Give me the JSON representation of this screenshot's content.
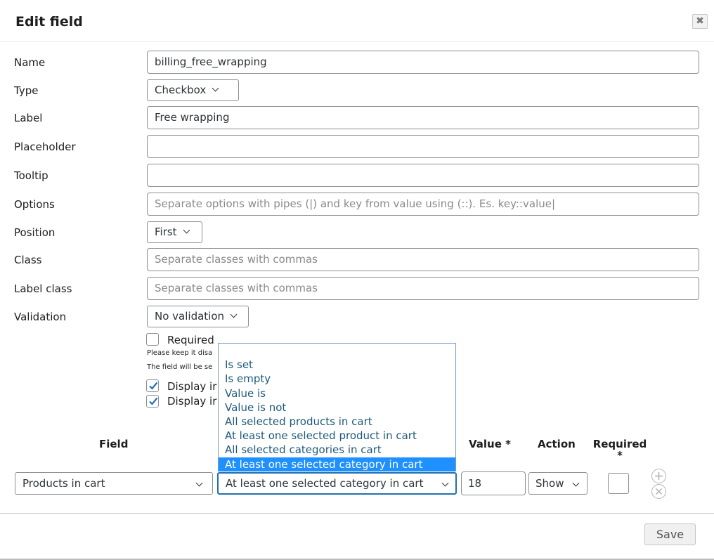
{
  "dialog": {
    "title": "Edit field",
    "close_symbol": "✖",
    "save_label": "Save"
  },
  "form": {
    "name": {
      "label": "Name",
      "value": "billing_free_wrapping"
    },
    "type": {
      "label": "Type",
      "value": "Checkbox"
    },
    "label_field": {
      "label": "Label",
      "value": "Free wrapping"
    },
    "placeholder": {
      "label": "Placeholder",
      "value": ""
    },
    "tooltip": {
      "label": "Tooltip",
      "value": ""
    },
    "options": {
      "label": "Options",
      "placeholder": "Separate options with pipes (|) and key from value using (::). Es. key::value|"
    },
    "position": {
      "label": "Position",
      "value": "First"
    },
    "class_field": {
      "label": "Class",
      "placeholder": "Separate classes with commas"
    },
    "label_class": {
      "label": "Label class",
      "placeholder": "Separate classes with commas"
    },
    "validation": {
      "label": "Validation",
      "value": "No validation"
    },
    "required": {
      "label": "Required",
      "checked": false
    },
    "note_1": "Please keep it disa",
    "note_2": "The field will be se",
    "display_1": {
      "label": "Display ir",
      "checked": true
    },
    "display_2": {
      "label": "Display ir",
      "checked": true
    }
  },
  "conditions": {
    "headers": {
      "field": "Field",
      "value": "Value *",
      "action": "Action",
      "required": "Required",
      "required_star": "*"
    },
    "row": {
      "field": "Products in cart",
      "condition": "At least one selected category in cart",
      "value": "18",
      "action": "Show",
      "required_checked": false
    }
  },
  "dropdown": {
    "items": [
      "",
      "Is set",
      "Is empty",
      "Value is",
      "Value is not",
      "All selected products in cart",
      "At least one selected product in cart",
      "All selected categories in cart",
      "At least one selected category in cart"
    ],
    "selected_index": 8
  },
  "colors": {
    "dropdown_highlight": "#1e90ff",
    "dropdown_text": "#1f5a7a",
    "focus_border": "#2271b1"
  }
}
